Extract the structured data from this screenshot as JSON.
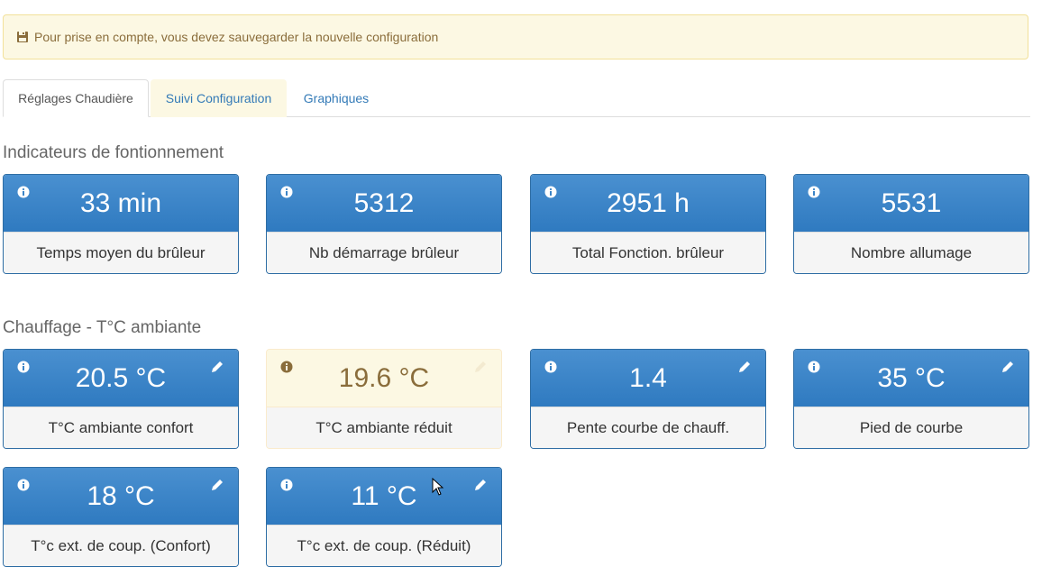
{
  "alert": {
    "message": "Pour prise en compte, vous devez sauvegarder la nouvelle configuration",
    "icon": "save-icon",
    "color": "#8a6d3b"
  },
  "tabs": [
    {
      "label": "Réglages Chaudière",
      "active": true
    },
    {
      "label": "Suivi Configuration",
      "active": false
    },
    {
      "label": "Graphiques",
      "active": false
    }
  ],
  "sections": {
    "indicators": {
      "title": "Indicateurs de fontionnement",
      "cards": [
        {
          "value": "33 min",
          "label": "Temps moyen du brûleur"
        },
        {
          "value": "5312",
          "label": "Nb démarrage brûleur"
        },
        {
          "value": "2951 h",
          "label": "Total Fonction. brûleur"
        },
        {
          "value": "5531",
          "label": "Nombre allumage"
        }
      ]
    },
    "heating": {
      "title": "Chauffage - T°C ambiante",
      "cards": [
        {
          "value": "20.5 °C",
          "label": "T°C ambiante confort"
        },
        {
          "value": "19.6 °C",
          "label": "T°C ambiante réduit"
        },
        {
          "value": "1.4",
          "label": "Pente courbe de chauff."
        },
        {
          "value": "35 °C",
          "label": "Pied de courbe"
        },
        {
          "value": "18 °C",
          "label": "T°c ext. de coup. (Confort)"
        },
        {
          "value": "11 °C",
          "label": "T°c ext. de coup. (Réduit)"
        }
      ]
    }
  },
  "colors": {
    "primary": "#337ab7",
    "warning_bg": "#fcf8e3",
    "warning_text": "#8a6d3b"
  }
}
